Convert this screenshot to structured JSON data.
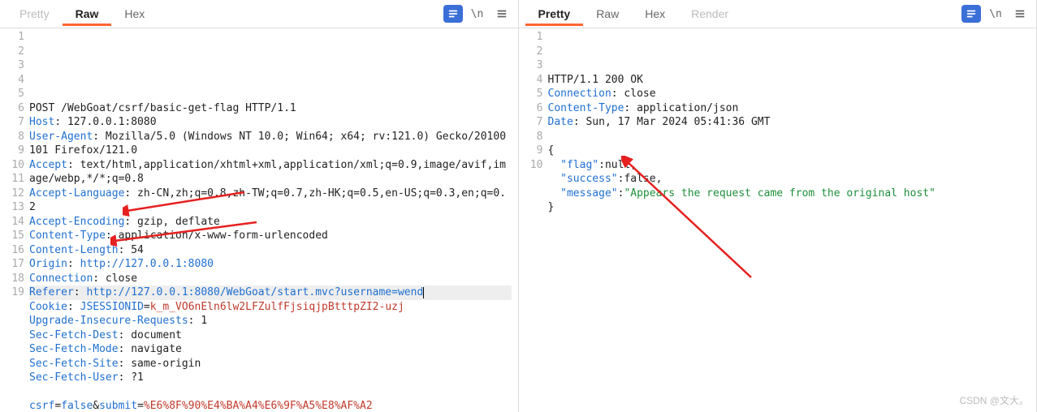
{
  "request": {
    "tabs": [
      "Pretty",
      "Raw",
      "Hex"
    ],
    "active_tab": "Raw",
    "lines": [
      {
        "n": 1,
        "segs": [
          {
            "t": "POST /WebGoat/csrf/basic-get-flag HTTP/1.1",
            "c": "plain"
          }
        ]
      },
      {
        "n": 2,
        "segs": [
          {
            "t": "Host",
            "c": "hdr"
          },
          {
            "t": ": 127.0.0.1:8080",
            "c": "val"
          }
        ]
      },
      {
        "n": 3,
        "segs": [
          {
            "t": "User-Agent",
            "c": "hdr"
          },
          {
            "t": ": Mozilla/5.0 (Windows NT 10.0; Win64; x64; rv:121.0) Gecko/20100101 Firefox/121.0",
            "c": "val"
          }
        ]
      },
      {
        "n": 4,
        "segs": [
          {
            "t": "Accept",
            "c": "hdr"
          },
          {
            "t": ": text/html,application/xhtml+xml,application/xml;q=0.9,image/avif,image/webp,*/*;q=0.8",
            "c": "val"
          }
        ]
      },
      {
        "n": 5,
        "segs": [
          {
            "t": "Accept-Language",
            "c": "hdr"
          },
          {
            "t": ": zh-CN,zh;q=0.8,zh-TW;q=0.7,zh-HK;q=0.5,en-US;q=0.3,en;q=0.2",
            "c": "val"
          }
        ]
      },
      {
        "n": 6,
        "segs": [
          {
            "t": "Accept-Encoding",
            "c": "hdr"
          },
          {
            "t": ": gzip, deflate",
            "c": "val"
          }
        ]
      },
      {
        "n": 7,
        "segs": [
          {
            "t": "Content-Type",
            "c": "hdr"
          },
          {
            "t": ": application/x-www-form-urlencoded",
            "c": "val"
          }
        ]
      },
      {
        "n": 8,
        "segs": [
          {
            "t": "Content-Length",
            "c": "hdr"
          },
          {
            "t": ": 54",
            "c": "val"
          }
        ]
      },
      {
        "n": 9,
        "segs": [
          {
            "t": "Origin",
            "c": "hdr"
          },
          {
            "t": ": ",
            "c": "val"
          },
          {
            "t": "http://127.0.0.1:8080",
            "c": "url"
          }
        ]
      },
      {
        "n": 10,
        "segs": [
          {
            "t": "Connection",
            "c": "hdr"
          },
          {
            "t": ": close",
            "c": "val"
          }
        ]
      },
      {
        "n": 11,
        "current": true,
        "cursor": true,
        "segs": [
          {
            "t": "Referer",
            "c": "hdr"
          },
          {
            "t": ": ",
            "c": "val"
          },
          {
            "t": "http://127.0.0.1:8080/WebGoat/start.mvc?username=wend",
            "c": "url"
          }
        ]
      },
      {
        "n": 12,
        "segs": [
          {
            "t": "Cookie",
            "c": "hdr"
          },
          {
            "t": ": ",
            "c": "val"
          },
          {
            "t": "JSESSIONID",
            "c": "kw"
          },
          {
            "t": "=",
            "c": "val"
          },
          {
            "t": "k_m_VO6nEln6lw2LFZulfFjsiqjpBtttpZI2-uzj",
            "c": "sid"
          }
        ]
      },
      {
        "n": 13,
        "segs": [
          {
            "t": "Upgrade-Insecure-Requests",
            "c": "hdr"
          },
          {
            "t": ": 1",
            "c": "val"
          }
        ]
      },
      {
        "n": 14,
        "segs": [
          {
            "t": "Sec-Fetch-Dest",
            "c": "hdr"
          },
          {
            "t": ": document",
            "c": "val"
          }
        ]
      },
      {
        "n": 15,
        "segs": [
          {
            "t": "Sec-Fetch-Mode",
            "c": "hdr"
          },
          {
            "t": ": navigate",
            "c": "val"
          }
        ]
      },
      {
        "n": 16,
        "segs": [
          {
            "t": "Sec-Fetch-Site",
            "c": "hdr"
          },
          {
            "t": ": same-origin",
            "c": "val"
          }
        ]
      },
      {
        "n": 17,
        "segs": [
          {
            "t": "Sec-Fetch-User",
            "c": "hdr"
          },
          {
            "t": ": ?1",
            "c": "val"
          }
        ]
      },
      {
        "n": 18,
        "segs": [
          {
            "t": "",
            "c": "val"
          }
        ]
      },
      {
        "n": 19,
        "segs": [
          {
            "t": "csrf",
            "c": "kw"
          },
          {
            "t": "=",
            "c": "val"
          },
          {
            "t": "false",
            "c": "url"
          },
          {
            "t": "&",
            "c": "val"
          },
          {
            "t": "submit",
            "c": "kw"
          },
          {
            "t": "=",
            "c": "val"
          },
          {
            "t": "%E6%8F%90%E4%BA%A4%E6%9F%A5%E8%AF%A2",
            "c": "enc"
          }
        ]
      }
    ]
  },
  "response": {
    "tabs": [
      "Pretty",
      "Raw",
      "Hex",
      "Render"
    ],
    "active_tab": "Pretty",
    "lines": [
      {
        "n": 1,
        "segs": [
          {
            "t": "HTTP/1.1 200 OK",
            "c": "plain"
          }
        ]
      },
      {
        "n": 2,
        "segs": [
          {
            "t": "Connection",
            "c": "hdr"
          },
          {
            "t": ": close",
            "c": "val"
          }
        ]
      },
      {
        "n": 3,
        "segs": [
          {
            "t": "Content-Type",
            "c": "hdr"
          },
          {
            "t": ": application/json",
            "c": "val"
          }
        ]
      },
      {
        "n": 4,
        "segs": [
          {
            "t": "Date",
            "c": "hdr"
          },
          {
            "t": ": Sun, 17 Mar 2024 05:41:36 GMT",
            "c": "val"
          }
        ]
      },
      {
        "n": 5,
        "segs": [
          {
            "t": "",
            "c": "val"
          }
        ]
      },
      {
        "n": 6,
        "segs": [
          {
            "t": "{",
            "c": "plain"
          }
        ]
      },
      {
        "n": 7,
        "segs": [
          {
            "t": "  ",
            "c": "plain"
          },
          {
            "t": "\"flag\"",
            "c": "hdr"
          },
          {
            "t": ":",
            "c": "plain"
          },
          {
            "t": "null",
            "c": "num"
          },
          {
            "t": ",",
            "c": "plain"
          }
        ]
      },
      {
        "n": 8,
        "segs": [
          {
            "t": "  ",
            "c": "plain"
          },
          {
            "t": "\"success\"",
            "c": "hdr"
          },
          {
            "t": ":",
            "c": "plain"
          },
          {
            "t": "false",
            "c": "num"
          },
          {
            "t": ",",
            "c": "plain"
          }
        ]
      },
      {
        "n": 9,
        "segs": [
          {
            "t": "  ",
            "c": "plain"
          },
          {
            "t": "\"message\"",
            "c": "hdr"
          },
          {
            "t": ":",
            "c": "plain"
          },
          {
            "t": "\"Appears the request came from the original host\"",
            "c": "str"
          }
        ]
      },
      {
        "n": 10,
        "segs": [
          {
            "t": "}",
            "c": "plain"
          }
        ]
      }
    ]
  },
  "icons": {
    "newline_label": "\\n"
  },
  "watermark": "CSDN @文大。"
}
